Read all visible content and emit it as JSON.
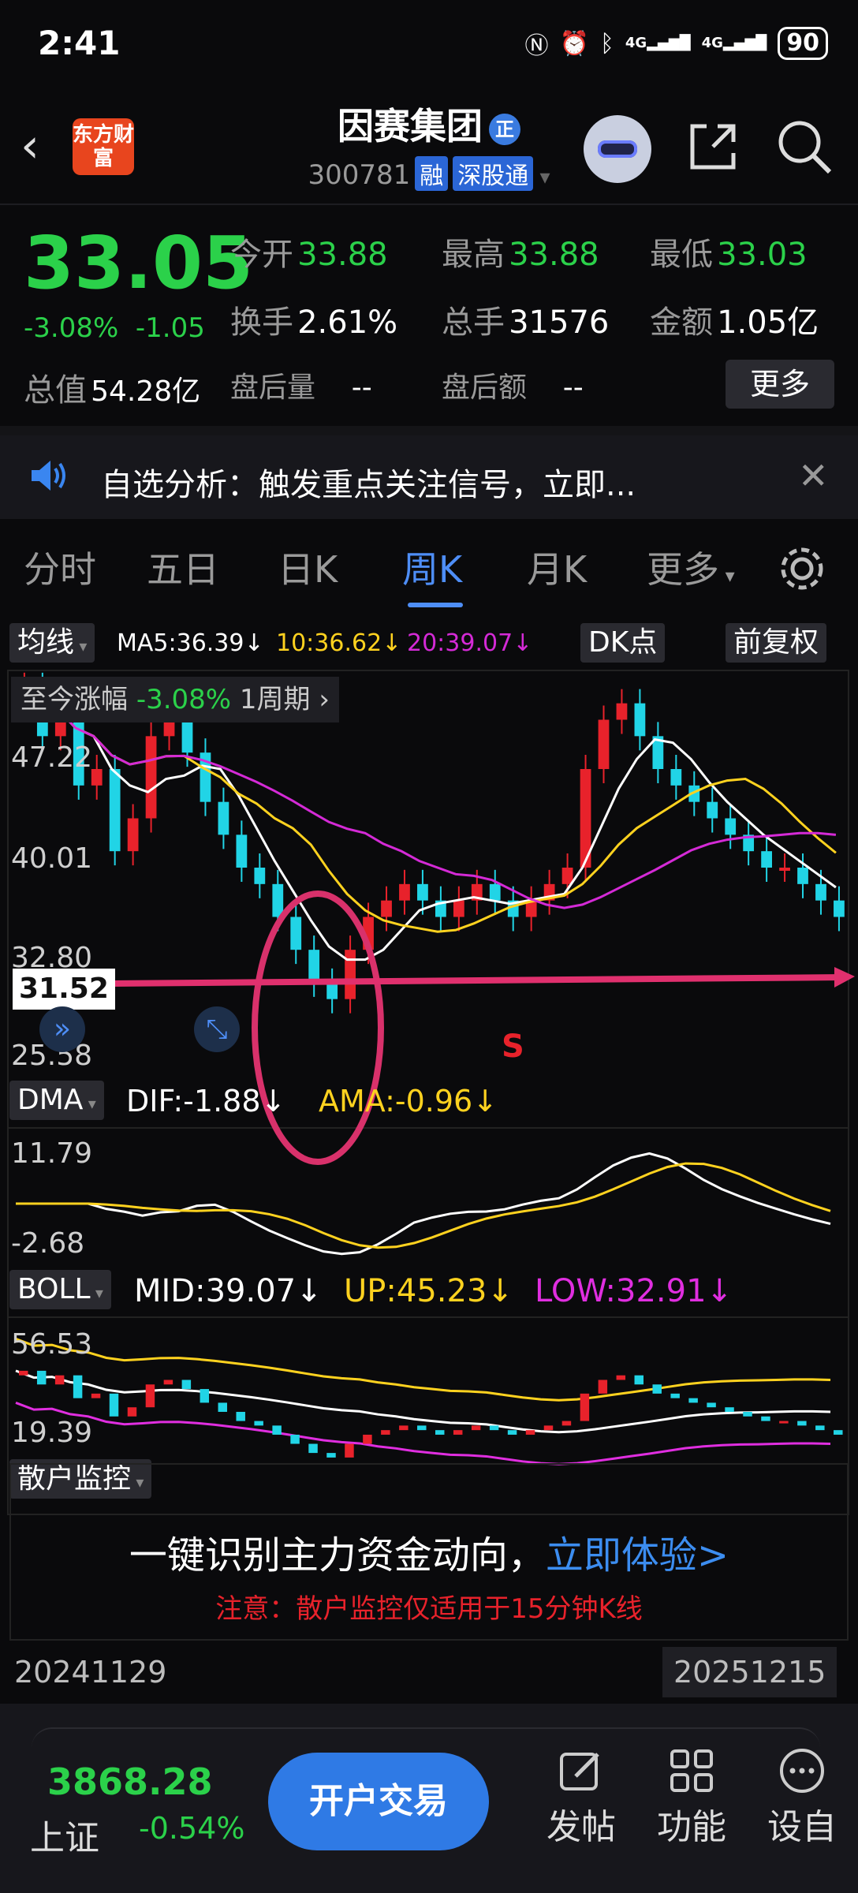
{
  "status_bar": {
    "time": "2:41",
    "network": "4G",
    "battery": "90"
  },
  "header": {
    "logo_text": "东方财富",
    "stock_name": "因赛集团",
    "name_badge": "正",
    "code": "300781",
    "tag_margin": "融",
    "tag_connect": "深股通"
  },
  "quote": {
    "price": "33.05",
    "change_pct": "-3.08%",
    "change_abs": "-1.05",
    "open_label": "今开",
    "open": "33.88",
    "high_label": "最高",
    "high": "33.88",
    "low_label": "最低",
    "low": "33.03",
    "turnover_label": "换手",
    "turnover": "2.61%",
    "volume_label": "总手",
    "volume": "31576",
    "amount_label": "金额",
    "amount": "1.05亿",
    "mktcap_label": "总值",
    "mktcap": "54.28亿",
    "after_vol_label": "盘后量",
    "after_vol": "--",
    "after_amt_label": "盘后额",
    "after_amt": "--",
    "more_label": "更多"
  },
  "notice": {
    "text": "自选分析：触发重点关注信号，立即..."
  },
  "tabs": [
    "分时",
    "五日",
    "日K",
    "周K",
    "月K",
    "更多"
  ],
  "active_tab": "周K",
  "kline": {
    "indicator_label": "均线",
    "ma5": "MA5:36.39↓",
    "ma10": "10:36.62↓",
    "ma20": "20:39.07↓",
    "dk_label": "DK点",
    "adjust_label": "前复权",
    "range_label": "至今涨幅",
    "range_value": "-3.08%",
    "range_period": "1周期",
    "y_ticks": [
      "47.22",
      "40.01",
      "32.80",
      "25.58"
    ],
    "marker_price": "31.52",
    "signal": "S"
  },
  "dma": {
    "label": "DMA",
    "dif": "DIF:-1.88↓",
    "ama": "AMA:-0.96↓",
    "y_ticks": [
      "11.79",
      "-2.68"
    ]
  },
  "boll": {
    "label": "BOLL",
    "mid": "MID:39.07↓",
    "up": "UP:45.23↓",
    "low": "LOW:32.91↓",
    "y_ticks": [
      "56.53",
      "19.39"
    ]
  },
  "retail": {
    "label": "散户监控",
    "headline": "一键识别主力资金动向，",
    "cta": "立即体验>",
    "note": "注意：散户监控仅适用于15分钟K线"
  },
  "dates": {
    "start": "20241129",
    "end": "20251215"
  },
  "bottom": {
    "index_value": "3868.28",
    "index_name": "上证",
    "index_change": "-0.54%",
    "trade_label": "开户交易",
    "post_label": "发帖",
    "func_label": "功能",
    "self_label": "设自"
  },
  "colors": {
    "up": "#e8222b",
    "down": "#21d4e6",
    "green": "#2bd14a",
    "accent": "#4e8ef7",
    "ma5": "#ffffff",
    "ma10": "#ffd21f",
    "ma20": "#d42ad6",
    "arrow": "#e0306e"
  }
}
